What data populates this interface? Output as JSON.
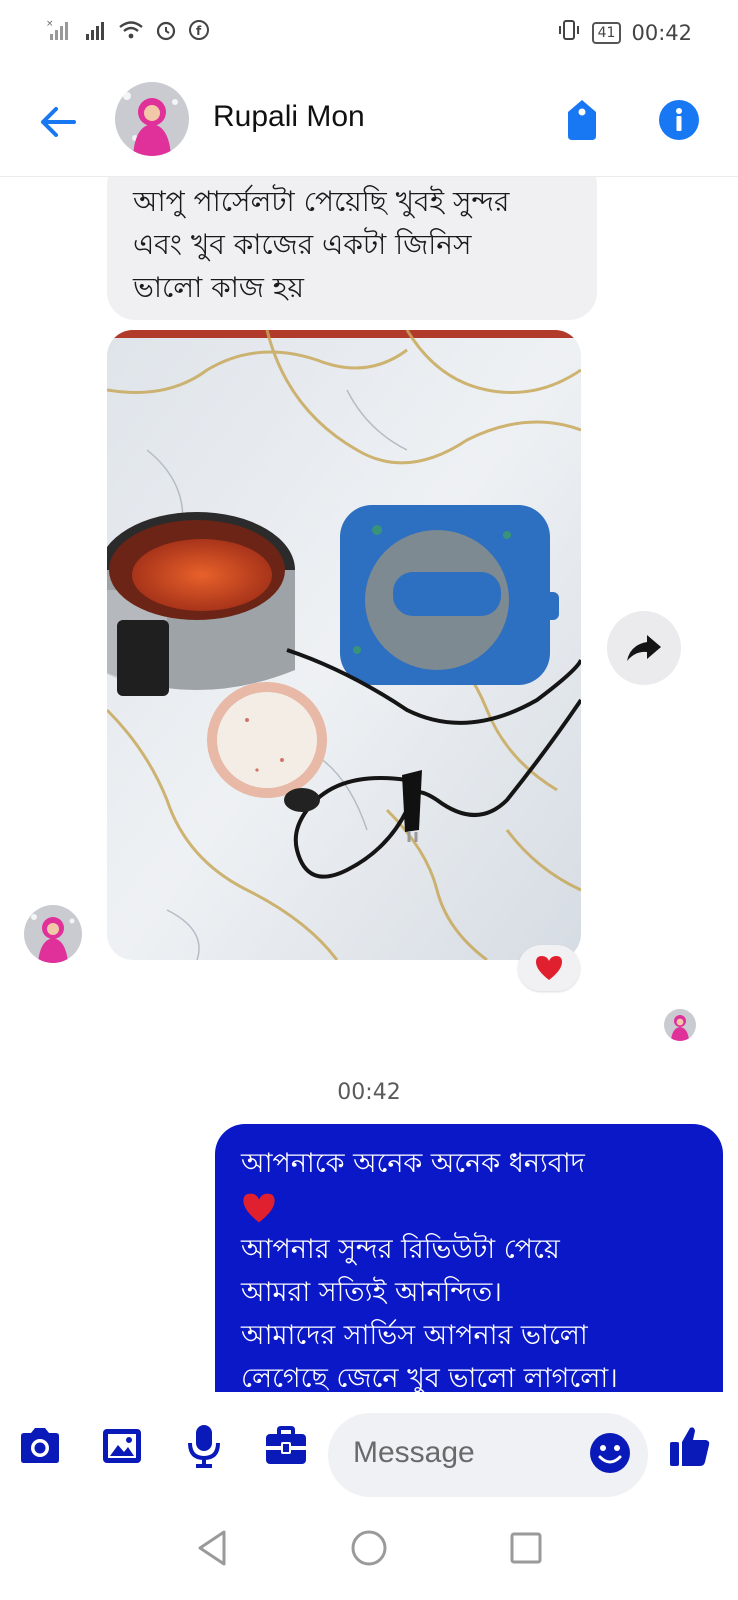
{
  "status_bar": {
    "battery": "41",
    "time": "00:42",
    "icons": [
      "no-sim-signal-icon",
      "signal-icon",
      "wifi-icon",
      "alarm-icon",
      "facebook-icon",
      "vibrate-icon",
      "battery-icon"
    ]
  },
  "header": {
    "contact_name": "Rupali Mon",
    "back_icon": "arrow-left-icon",
    "tag_icon": "tag-icon",
    "info_icon": "info-icon"
  },
  "messages": {
    "incoming_text": "আপু পার্সেলটা পেয়েছি খুবই সুন্দর\nএবং খুব কাজের একটা জিনিস\nভালো কাজ হয়",
    "reaction": "❤️",
    "timestamp": "00:42",
    "outgoing_lines": [
      "আপনাকে অনেক অনেক ধন্যবাদ",
      "❤️",
      "আপনার সুন্দর রিভিউটা পেয়ে",
      "আমরা সত্যিই আনন্দিত।",
      "আমাদের সার্ভিস আপনার ভালো",
      "লেগেছে জেনে খুব ভালো লাগলো।"
    ]
  },
  "composer": {
    "placeholder": "Message",
    "icons": [
      "camera-icon",
      "gallery-icon",
      "mic-icon",
      "briefcase-icon",
      "emoji-icon",
      "like-icon"
    ]
  },
  "colors": {
    "messenger_blue": "#1877f2",
    "outgoing_bubble": "#0b18c8",
    "composer_icon": "#0a1ab8",
    "heart_red": "#e0202f"
  }
}
